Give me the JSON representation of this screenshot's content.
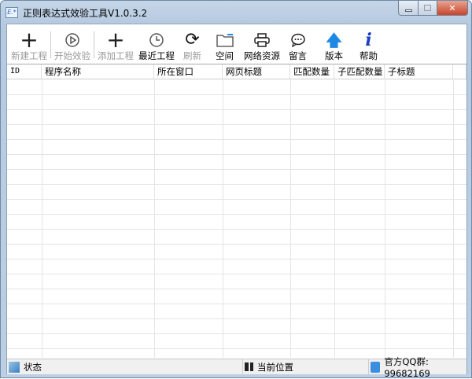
{
  "window": {
    "title": "正则表达式效验工具V1.0.3.2"
  },
  "toolbar": {
    "items": [
      {
        "label": "新建工程",
        "icon": "plus-icon",
        "enabled": false
      },
      {
        "label": "开始效验",
        "icon": "play-icon",
        "enabled": false
      },
      {
        "label": "添加工程",
        "icon": "plus-icon",
        "enabled": false
      },
      {
        "label": "最近工程",
        "icon": "clock-icon",
        "enabled": true
      },
      {
        "label": "刷新",
        "icon": "refresh-icon",
        "enabled": false
      },
      {
        "label": "空间",
        "icon": "folder-icon",
        "enabled": true
      },
      {
        "label": "网络资源",
        "icon": "printer-icon",
        "enabled": true
      },
      {
        "label": "留言",
        "icon": "chat-icon",
        "enabled": true
      },
      {
        "label": "版本",
        "icon": "arrow-up-icon",
        "enabled": true
      },
      {
        "label": "帮助",
        "icon": "info-icon",
        "enabled": true
      }
    ]
  },
  "table": {
    "columns": [
      "ID",
      "程序名称",
      "所在窗口",
      "网页标题",
      "匹配数量",
      "子匹配数量",
      "子标题"
    ],
    "rows": []
  },
  "status": {
    "state": "状态",
    "position": "当前位置",
    "qq": "官方QQ群: 99682169"
  },
  "colors": {
    "accent": "#1e88e5",
    "info": "#1a3fc0"
  }
}
